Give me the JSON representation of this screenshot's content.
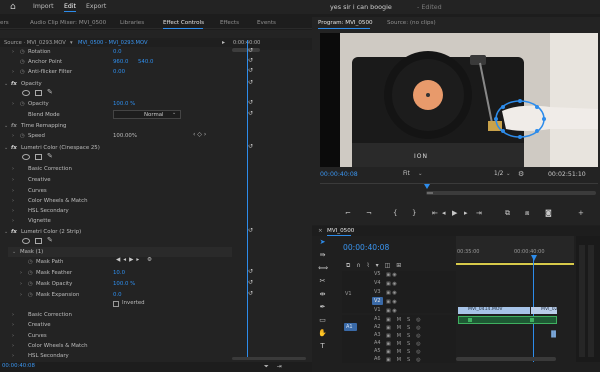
{
  "titlebar": {
    "nav": [
      "Import",
      "Edit",
      "Export"
    ],
    "active_nav": "Edit",
    "document_title": "yes sir i can boogie",
    "edited_label": "- Edited"
  },
  "left_tabs": [
    "ers",
    "Audio Clip Mixer: MVI_0500",
    "Libraries",
    "Effect Controls",
    "Effects",
    "Events"
  ],
  "effect_controls": {
    "source_label": "Source · MVI_0293.MOV",
    "source_sep": "▾",
    "sequence_label": "MVI_0500 - MVI_0293.MOV",
    "ruler_time": "0:00:40:00",
    "timecode": "00:00:40:08",
    "rows": {
      "rotation": {
        "label": "Rotation",
        "value": "0.0"
      },
      "anchor": {
        "label": "Anchor Point",
        "value_x": "960.0",
        "value_y": "540.0"
      },
      "antiflicker": {
        "label": "Anti-flicker Filter",
        "value": "0.00"
      },
      "opacity_hdr": {
        "label": "Opacity"
      },
      "opacity": {
        "label": "Opacity",
        "value": "100.0 %"
      },
      "blend": {
        "label": "Blend Mode",
        "value": "Normal"
      },
      "timeremap": {
        "label": "Time Remapping"
      },
      "speed": {
        "label": "Speed",
        "value": "100.00%"
      },
      "lumetri1": {
        "label": "Lumetri Color (Cinespace 25)"
      },
      "basic": {
        "label": "Basic Correction"
      },
      "creative": {
        "label": "Creative"
      },
      "curves": {
        "label": "Curves"
      },
      "cwm": {
        "label": "Color Wheels & Match"
      },
      "hsl": {
        "label": "HSL Secondary"
      },
      "vignette": {
        "label": "Vignette"
      },
      "lumetri2": {
        "label": "Lumetri Color (2 Strip)"
      },
      "mask": {
        "label": "Mask (1)"
      },
      "maskpath": {
        "label": "Mask Path"
      },
      "feather": {
        "label": "Mask Feather",
        "value": "10.0"
      },
      "mopacity": {
        "label": "Mask Opacity",
        "value": "100.0 %"
      },
      "expansion": {
        "label": "Mask Expansion",
        "value": "0.0"
      },
      "inverted": {
        "label": "Inverted"
      },
      "basic2": {
        "label": "Basic Correction"
      },
      "creative2": {
        "label": "Creative"
      },
      "curves2": {
        "label": "Curves"
      },
      "cwm2": {
        "label": "Color Wheels & Match"
      },
      "hsl2": {
        "label": "HSL Secondary"
      }
    }
  },
  "program": {
    "tab": "Program: MVI_0500",
    "tab2": "Source: (no clips)",
    "timecode": "00:00:40:08",
    "fit": "Fit",
    "ratio": "1/2",
    "duration": "00:02:51:10",
    "brand": "ION"
  },
  "timeline": {
    "tab": "MVI_0500",
    "timecode": "00:00:40:08",
    "ruler": [
      "00:35:00",
      "00:00:40:00"
    ],
    "tracks": [
      "V5",
      "V4",
      "V3",
      "V2",
      "V1",
      "A1",
      "A2",
      "A3",
      "A4",
      "A5",
      "A6"
    ],
    "v1": "V1",
    "a1": "A1",
    "clip1": "MVI_0414.MOV",
    "clip2": "MVI_029"
  },
  "colors": {
    "accent": "#2d8ceb",
    "value_blue": "#2f8fef",
    "clip_blue": "#a7c4e8",
    "audio_green": "#3fb060"
  }
}
